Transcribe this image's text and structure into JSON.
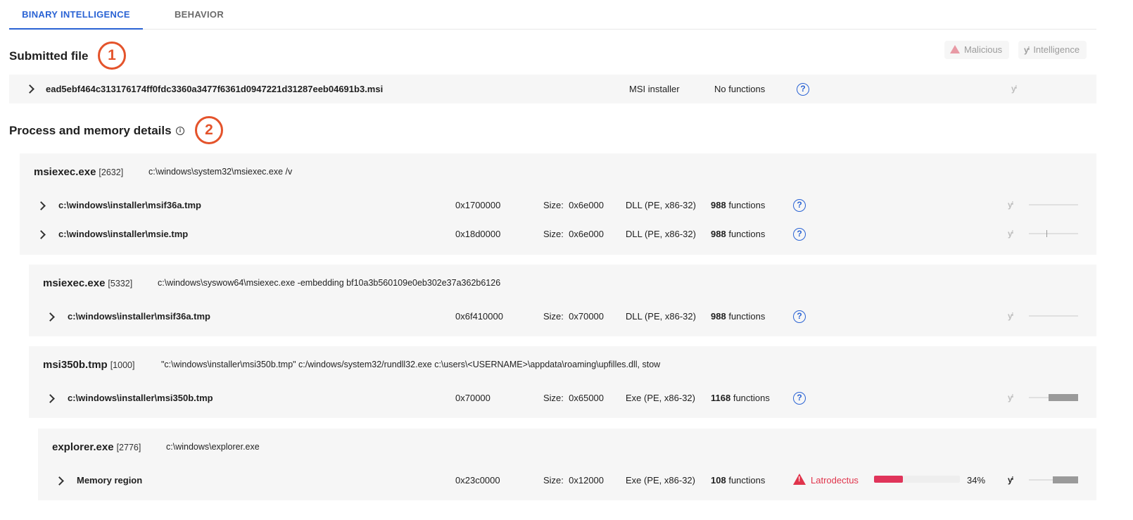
{
  "tabs": [
    {
      "label": "BINARY INTELLIGENCE",
      "active": true
    },
    {
      "label": "BEHAVIOR",
      "active": false
    }
  ],
  "submitted": {
    "title": "Submitted file",
    "annotation": "1",
    "file": {
      "name": "ead5ebf464c313176174ff0fdc3360a3477f6361d0947221d31287eeb04691b3.msi",
      "type": "MSI installer",
      "functions_text": "No functions",
      "help": "?",
      "yi": "yⁱ"
    }
  },
  "filters": {
    "malicious": "Malicious",
    "intelligence": "Intelligence",
    "yi": "yⁱ"
  },
  "process_section": {
    "title": "Process and memory details",
    "info": "i",
    "annotation": "2"
  },
  "size_label": "Size:",
  "functions_label": "functions",
  "processes": [
    {
      "name": "msiexec.exe",
      "pid": "[2632]",
      "cmd": "c:\\windows\\system32\\msiexec.exe /v",
      "rows": [
        {
          "path": "c:\\windows\\installer\\msif36a.tmp",
          "addr": "0x1700000",
          "size": "0x6e000",
          "type": "DLL (PE, x86-32)",
          "functions": "988",
          "level": 0
        },
        {
          "path": "c:\\windows\\installer\\msie.tmp",
          "addr": "0x18d0000",
          "size": "0x6e000",
          "type": "DLL (PE, x86-32)",
          "functions": "988",
          "level": 0.05
        }
      ]
    },
    {
      "name": "msiexec.exe",
      "pid": "[5332]",
      "cmd": "c:\\windows\\syswow64\\msiexec.exe -embedding bf10a3b560109e0eb302e37a362b6126",
      "rows": [
        {
          "path": "c:\\windows\\installer\\msif36a.tmp",
          "addr": "0x6f410000",
          "size": "0x70000",
          "type": "DLL (PE, x86-32)",
          "functions": "988",
          "level": 0
        }
      ]
    },
    {
      "name": "msi350b.tmp",
      "pid": "[1000]",
      "cmd": "\"c:\\windows\\installer\\msi350b.tmp\" c:/windows/system32/rundll32.exe c:\\users\\<USERNAME>\\appdata\\roaming\\upfilles.dll, stow",
      "rows": [
        {
          "path": "c:\\windows\\installer\\msi350b.tmp",
          "addr": "0x70000",
          "size": "0x65000",
          "type": "Exe (PE, x86-32)",
          "functions": "1168",
          "level": 0.6
        }
      ]
    },
    {
      "name": "explorer.exe",
      "pid": "[2776]",
      "cmd": "c:\\windows\\explorer.exe",
      "rows": [
        {
          "path": "Memory region",
          "addr": "0x23c0000",
          "size": "0x12000",
          "type": "Exe (PE, x86-32)",
          "functions": "108",
          "level": 0.5,
          "family": "Latrodectus",
          "confidence": 34,
          "confidence_text": "34%"
        }
      ]
    }
  ]
}
